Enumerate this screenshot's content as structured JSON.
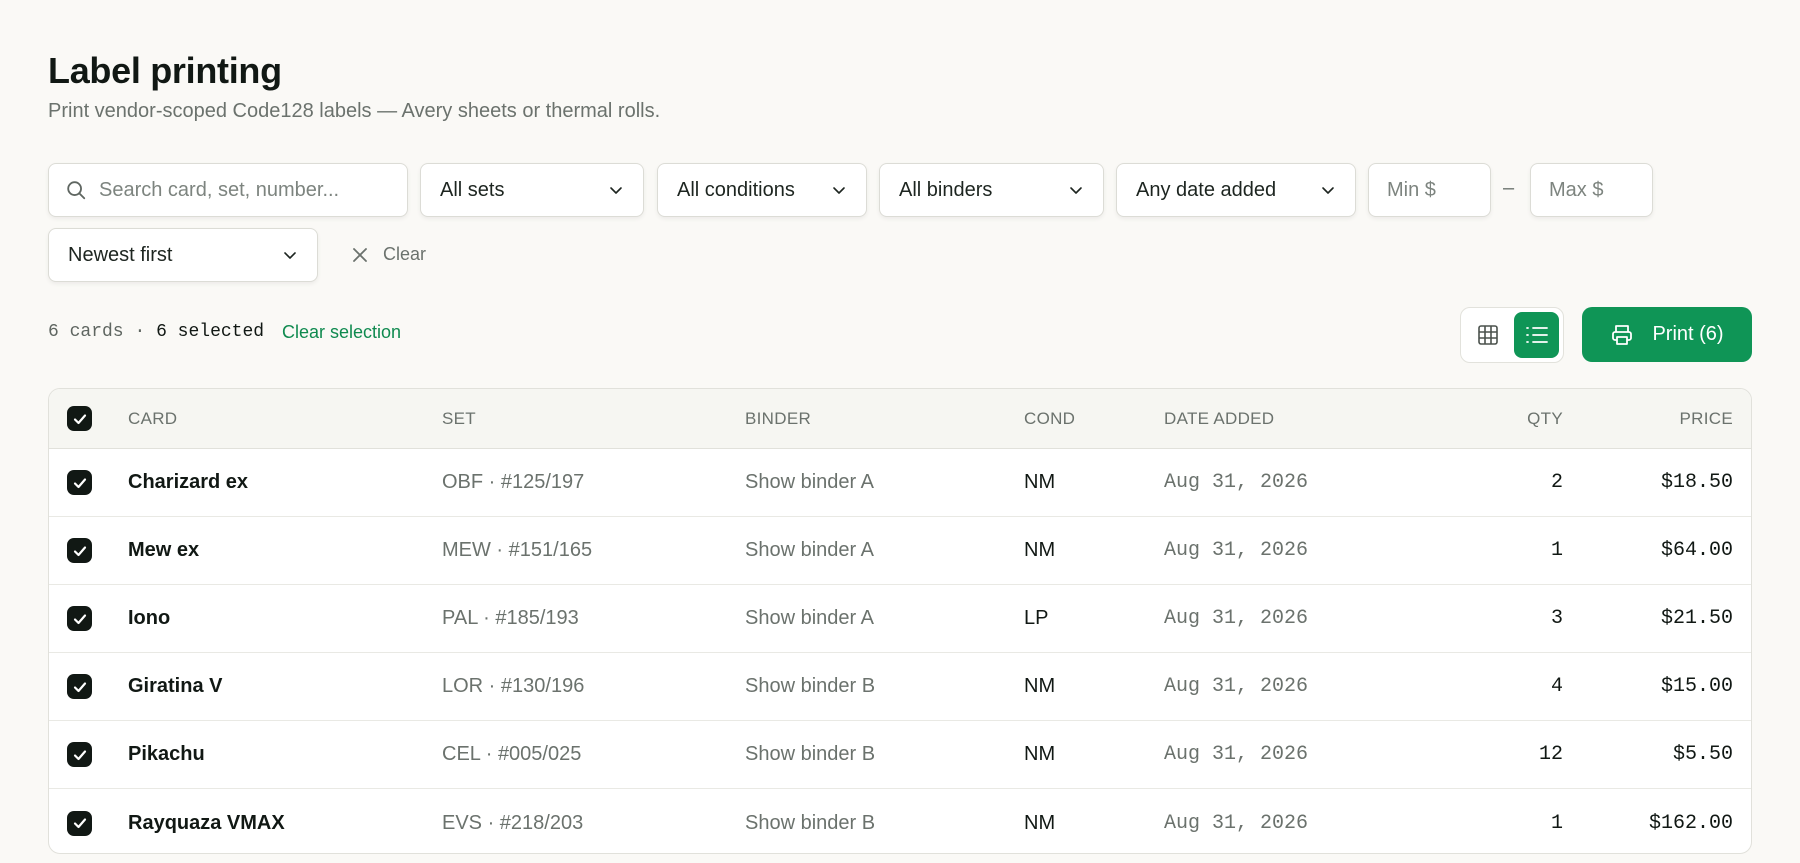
{
  "header": {
    "title": "Label printing",
    "subtitle": "Print vendor-scoped Code128 labels — Avery sheets or thermal rolls."
  },
  "filters": {
    "search_placeholder": "Search card, set, number...",
    "sets": "All sets",
    "conditions": "All conditions",
    "binders": "All binders",
    "date_added": "Any date added",
    "min_placeholder": "Min $",
    "range_separator": "–",
    "max_placeholder": "Max $",
    "sort": "Newest first",
    "clear_label": "Clear"
  },
  "summary": {
    "cards_count": "6 cards",
    "separator": "·",
    "selected_count": "6 selected",
    "clear_selection": "Clear selection"
  },
  "toolbar": {
    "view_mode": "list",
    "print_label": "Print (6)"
  },
  "table": {
    "columns": {
      "card": "CARD",
      "set": "SET",
      "binder": "BINDER",
      "cond": "COND",
      "date": "DATE ADDED",
      "qty": "QTY",
      "price": "PRICE"
    },
    "rows": [
      {
        "card": "Charizard ex",
        "set": "OBF · #125/197",
        "binder": "Show binder A",
        "cond": "NM",
        "date": "Aug 31, 2026",
        "qty": "2",
        "price": "$18.50",
        "checked": true
      },
      {
        "card": "Mew ex",
        "set": "MEW · #151/165",
        "binder": "Show binder A",
        "cond": "NM",
        "date": "Aug 31, 2026",
        "qty": "1",
        "price": "$64.00",
        "checked": true
      },
      {
        "card": "Iono",
        "set": "PAL · #185/193",
        "binder": "Show binder A",
        "cond": "LP",
        "date": "Aug 31, 2026",
        "qty": "3",
        "price": "$21.50",
        "checked": true
      },
      {
        "card": "Giratina V",
        "set": "LOR · #130/196",
        "binder": "Show binder B",
        "cond": "NM",
        "date": "Aug 31, 2026",
        "qty": "4",
        "price": "$15.00",
        "checked": true
      },
      {
        "card": "Pikachu",
        "set": "CEL · #005/025",
        "binder": "Show binder B",
        "cond": "NM",
        "date": "Aug 31, 2026",
        "qty": "12",
        "price": "$5.50",
        "checked": true
      },
      {
        "card": "Rayquaza VMAX",
        "set": "EVS · #218/203",
        "binder": "Show binder B",
        "cond": "NM",
        "date": "Aug 31, 2026",
        "qty": "1",
        "price": "$162.00",
        "checked": true
      }
    ]
  },
  "colors": {
    "accent": "#0f9556",
    "link": "#0f8a4f",
    "background": "#faf9f6"
  }
}
